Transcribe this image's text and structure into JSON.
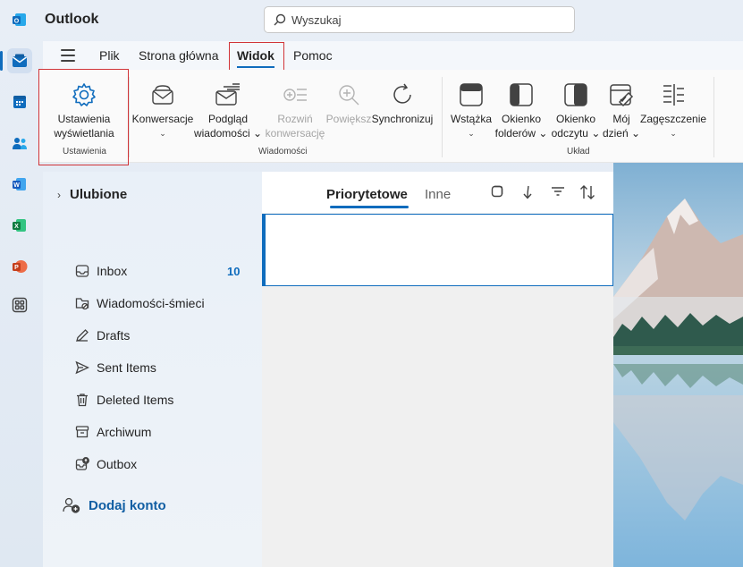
{
  "app": {
    "title": "Outlook"
  },
  "search": {
    "placeholder": "Wyszukaj"
  },
  "menu": {
    "tabs": [
      "Plik",
      "Strona główna",
      "Widok",
      "Pomoc"
    ],
    "active": "Widok"
  },
  "ribbon": {
    "settings": {
      "label1": "Ustawienia",
      "label2": "wyświetlania",
      "group": "Ustawienia"
    },
    "messages": {
      "group": "Wiadomości",
      "items": [
        {
          "l1": "Konwersacje",
          "l2": "⌄"
        },
        {
          "l1": "Podgląd",
          "l2": "wiadomości ⌄"
        },
        {
          "l1": "Rozwiń",
          "l2": "konwersację"
        },
        {
          "l1": "Powiększ",
          "l2": ""
        },
        {
          "l1": "Synchronizuj",
          "l2": ""
        }
      ]
    },
    "layout": {
      "group": "Układ",
      "items": [
        {
          "l1": "Wstążka",
          "l2": "⌄"
        },
        {
          "l1": "Okienko",
          "l2": "folderów ⌄"
        },
        {
          "l1": "Okienko",
          "l2": "odczytu ⌄"
        },
        {
          "l1": "Mój",
          "l2": "dzień ⌄"
        },
        {
          "l1": "Zagęszczenie",
          "l2": "⌄"
        }
      ]
    }
  },
  "folders": {
    "favorites": "Ulubione",
    "items": [
      {
        "label": "Inbox",
        "count": "10",
        "icon": "inbox-icon"
      },
      {
        "label": "Wiadomości-śmieci",
        "icon": "junk-icon"
      },
      {
        "label": "Drafts",
        "icon": "drafts-icon"
      },
      {
        "label": "Sent Items",
        "icon": "sent-icon"
      },
      {
        "label": "Deleted Items",
        "icon": "trash-icon"
      },
      {
        "label": "Archiwum",
        "icon": "archive-icon"
      },
      {
        "label": "Outbox",
        "icon": "outbox-icon"
      }
    ],
    "add_account": "Dodaj konto"
  },
  "messages": {
    "focused": "Priorytetowe",
    "other": "Inne"
  },
  "colors": {
    "accent": "#0f6cbd",
    "highlight_box": "#d13438"
  }
}
